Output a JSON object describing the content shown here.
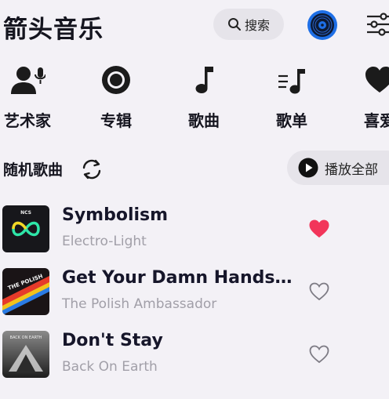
{
  "app": {
    "title": "箭头音乐"
  },
  "header": {
    "search_label": "搜索"
  },
  "categories": [
    {
      "label": "艺术家",
      "icon": "artist-mic-icon"
    },
    {
      "label": "专辑",
      "icon": "album-disc-icon"
    },
    {
      "label": "歌曲",
      "icon": "music-note-icon"
    },
    {
      "label": "歌单",
      "icon": "playlist-icon"
    },
    {
      "label": "喜爱",
      "icon": "heart-icon"
    }
  ],
  "section": {
    "title": "随机歌曲",
    "play_all_label": "播放全部"
  },
  "songs": [
    {
      "title": "Symbolism",
      "artist": "Electro-Light",
      "liked": true,
      "cover_text": "NCS"
    },
    {
      "title": "Get Your Damn Hands o…",
      "artist": "The Polish Ambassador",
      "liked": false,
      "cover_text": "THE POLISH"
    },
    {
      "title": "Don't Stay",
      "artist": "Back On Earth",
      "liked": false,
      "cover_text": "BACK ON EARTH"
    }
  ],
  "colors": {
    "accent": "#1e6fe6",
    "liked_heart": "#f2355a",
    "background": "#f3f1f6"
  }
}
